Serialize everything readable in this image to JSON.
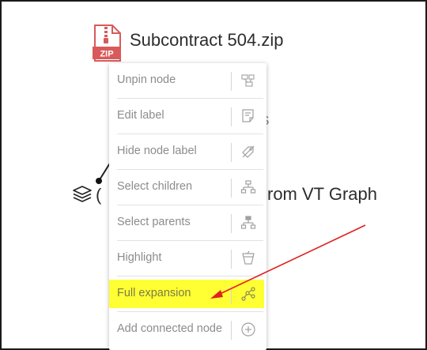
{
  "node": {
    "file_title": "Subcontract 504.zip",
    "zip_badge": "ZIP",
    "background_fragment_1": "s",
    "background_fragment_2": "rom VT Graph",
    "background_fragment_3": "("
  },
  "context_menu": {
    "items": [
      {
        "label": "Unpin node",
        "icon": "unpin-icon"
      },
      {
        "label": "Edit label",
        "icon": "edit-label-icon"
      },
      {
        "label": "Hide node label",
        "icon": "tags-icon"
      },
      {
        "label": "Select children",
        "icon": "children-tree-icon"
      },
      {
        "label": "Select parents",
        "icon": "parents-tree-icon"
      },
      {
        "label": "Highlight",
        "icon": "highlight-cup-icon"
      },
      {
        "label": "Full expansion",
        "icon": "expansion-graph-icon",
        "highlighted": true
      },
      {
        "label": "Add connected node",
        "icon": "add-circle-icon"
      }
    ]
  },
  "colors": {
    "highlight": "#ffff33",
    "annotation_arrow": "#e02020",
    "zip_icon": "#d95a5a"
  }
}
